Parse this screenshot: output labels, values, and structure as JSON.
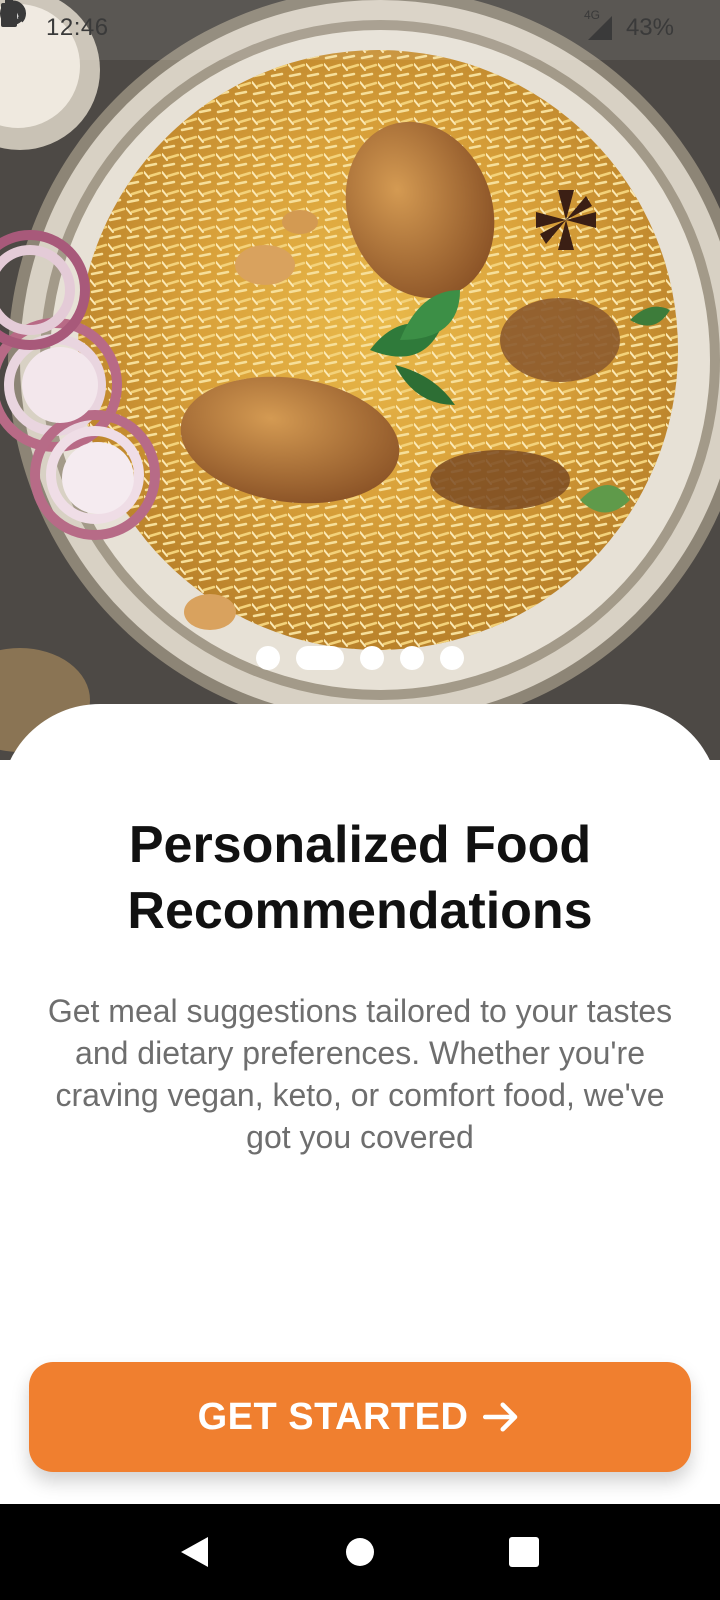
{
  "status_bar": {
    "time": "12:46",
    "network": "4G",
    "battery": "43%",
    "icons": [
      "whatsapp-icon",
      "app-a-icon",
      "hotspot-icon",
      "signal-icon",
      "battery-icon"
    ]
  },
  "hero": {
    "image": "biryani-plate-photo"
  },
  "pager": {
    "total": 5,
    "active_index": 1
  },
  "onboarding": {
    "title": "Personalized Food Recommendations",
    "description": "Get meal suggestions tailored to your tastes and dietary preferences. Whether you're craving vegan, keto, or comfort food, we've got you covered"
  },
  "cta": {
    "label": "GET STARTED",
    "icon": "arrow-right-icon",
    "color": "#f07f2f"
  },
  "navigation_bar": {
    "buttons": [
      "back-icon",
      "home-icon",
      "recents-icon"
    ]
  }
}
